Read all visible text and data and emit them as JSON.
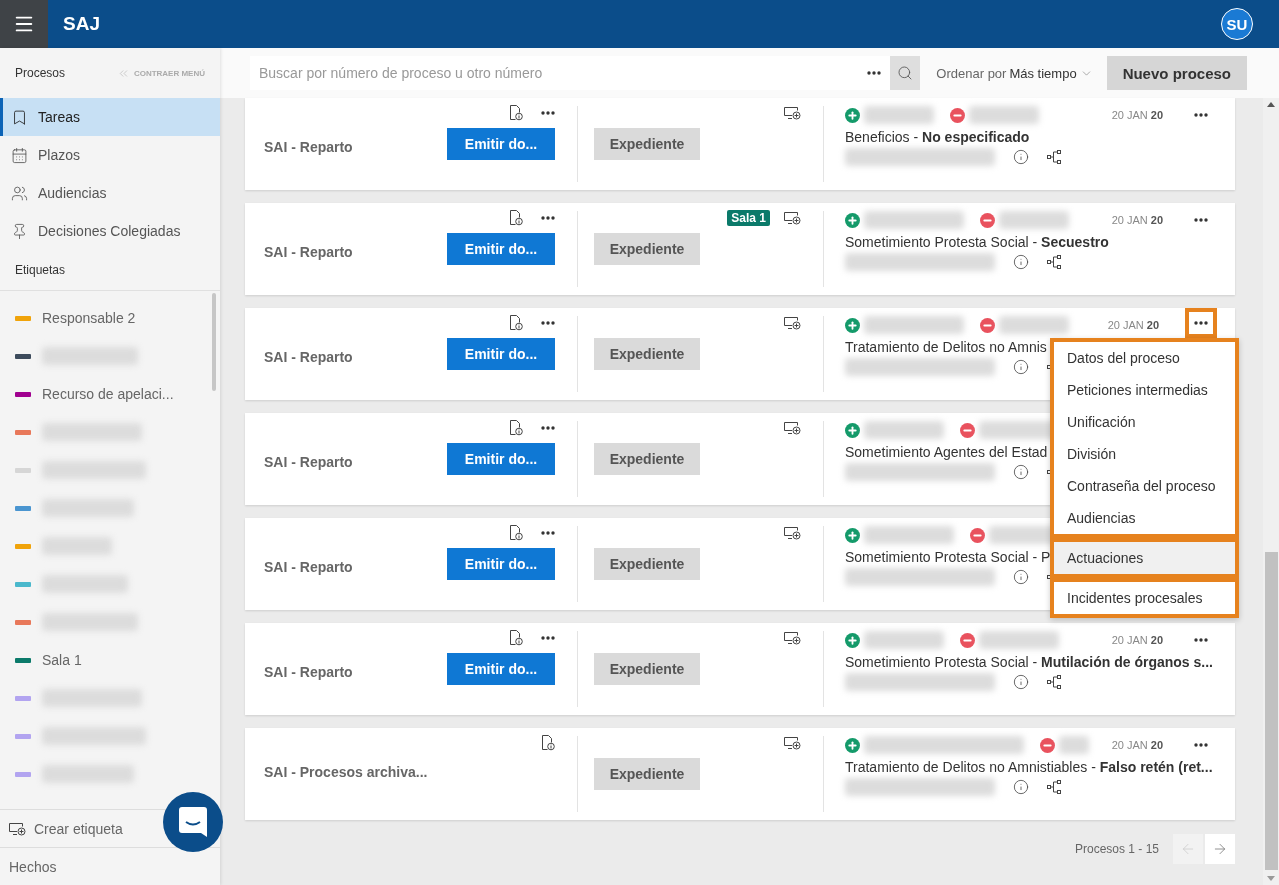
{
  "header": {
    "title": "SAJ",
    "avatar": "SU"
  },
  "sidebar": {
    "section": "Procesos",
    "collapse": "CONTRAER MENÚ",
    "nav": [
      {
        "kind": "bookmark",
        "label": "Tareas",
        "selected": true
      },
      {
        "kind": "calendar",
        "label": "Plazos",
        "selected": false
      },
      {
        "kind": "people",
        "label": "Audiencias",
        "selected": false
      },
      {
        "kind": "pin",
        "label": "Decisiones Colegiadas",
        "selected": false
      }
    ],
    "tags_title": "Etiquetas",
    "tags": [
      {
        "kind": "text",
        "label": "Responsable 2",
        "color": "#f0a30a"
      },
      {
        "kind": "redacted",
        "color": "#3d4b5c"
      },
      {
        "kind": "text",
        "label": "Recurso de apelaci...",
        "color": "#a0008f"
      },
      {
        "kind": "redacted",
        "color": "#e8785a"
      },
      {
        "kind": "redacted",
        "color": "#d6d6d6"
      },
      {
        "kind": "redacted",
        "color": "#4a95d0"
      },
      {
        "kind": "redacted",
        "color": "#f0a30a"
      },
      {
        "kind": "redacted",
        "color": "#4ab8cc"
      },
      {
        "kind": "redacted",
        "color": "#e8785a"
      },
      {
        "kind": "text",
        "label": "Sala 1",
        "color": "#0b7a6a"
      },
      {
        "kind": "redacted",
        "color": "#b2a4f0"
      },
      {
        "kind": "redacted",
        "color": "#b2a4f0"
      },
      {
        "kind": "redacted",
        "color": "#b2a4f0"
      }
    ],
    "create_tag": "Crear etiqueta",
    "footer": "Hechos"
  },
  "toolbar": {
    "search_placeholder": "Buscar por número de proceso u otro número",
    "sort_label": "Ordenar por",
    "sort_value": "Más tiempo",
    "new_button": "Nuevo proceso"
  },
  "cards": [
    {
      "title": "SAI - Reparto",
      "emit_button": "Emitir do...",
      "has_actions": true,
      "file_button": "Expediente",
      "date": "20 JAN **20**",
      "subject": "Beneficios - **No especificado**",
      "menu_highlighted": false
    },
    {
      "title": "SAI - Reparto",
      "emit_button": "Emitir do...",
      "has_actions": true,
      "file_button": "Expediente",
      "badge": "Sala 1",
      "date": "20 JAN **20**",
      "subject": "Sometimiento Protesta Social - **Secuestro**",
      "menu_highlighted": false
    },
    {
      "title": "SAI - Reparto",
      "emit_button": "Emitir do...",
      "has_actions": true,
      "file_button": "Expediente",
      "date": "20 JAN **20**",
      "subject": "Tratamiento de Delitos no Amnis",
      "menu_highlighted": true,
      "context_menu": {
        "groups": [
          [
            {
              "label": "Datos del proceso",
              "selected": false
            },
            {
              "label": "Peticiones intermedias",
              "selected": false
            },
            {
              "label": "Unificación",
              "selected": false
            },
            {
              "label": "División",
              "selected": false
            },
            {
              "label": "Contraseña del proceso",
              "selected": false
            },
            {
              "label": "Audiencias",
              "selected": false
            }
          ],
          [
            {
              "label": "Actuaciones",
              "selected": true
            }
          ],
          [
            {
              "label": "Incidentes procesales",
              "selected": false
            }
          ]
        ]
      }
    },
    {
      "title": "SAI - Reparto",
      "emit_button": "Emitir do...",
      "has_actions": true,
      "file_button": "Expediente",
      "subject": "Sometimiento Agentes del Estad"
    },
    {
      "title": "SAI - Reparto",
      "emit_button": "Emitir do...",
      "has_actions": true,
      "file_button": "Expediente",
      "subject": "Sometimiento Protesta Social - P"
    },
    {
      "title": "SAI - Reparto",
      "emit_button": "Emitir do...",
      "has_actions": true,
      "file_button": "Expediente",
      "date": "20 JAN **20**",
      "subject": "Sometimiento Protesta Social - **Mutilación de órganos s...**",
      "menu_highlighted": false
    },
    {
      "title": "SAI - Procesos archiva...",
      "has_actions": false,
      "file_button": "Expediente",
      "date": "20 JAN **20**",
      "subject": "Tratamiento de Delitos no Amnistiables - **Falso retén (ret...**",
      "menu_highlighted": false
    }
  ],
  "pagination": {
    "label": "Procesos 1 - 15",
    "prev_disabled": true,
    "next_disabled": false
  }
}
